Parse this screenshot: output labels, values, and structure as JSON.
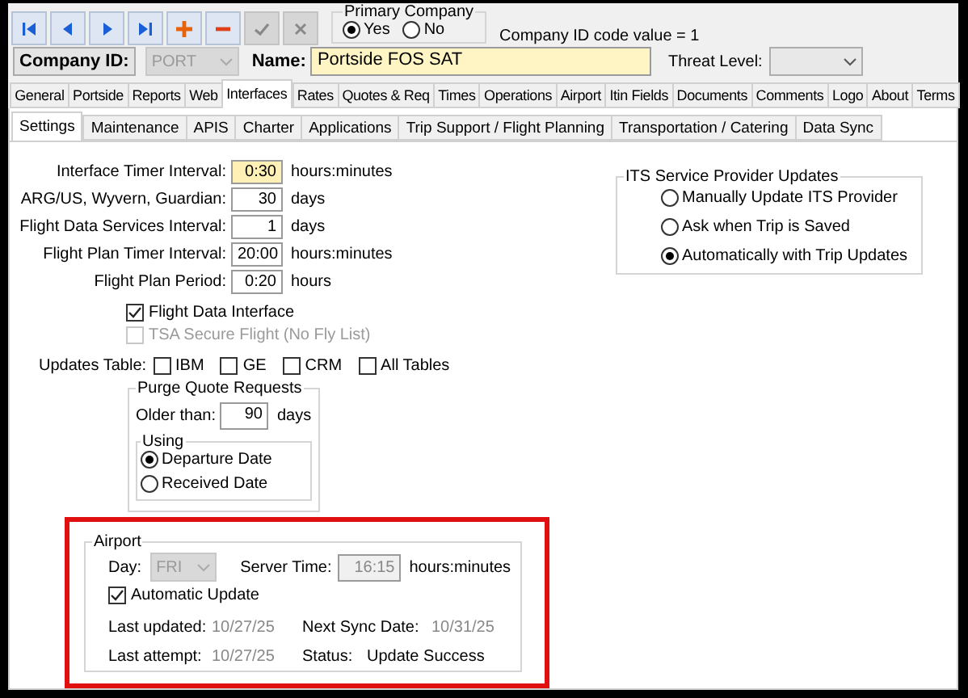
{
  "toolbar": {
    "buttons": [
      {
        "kind": "first",
        "disabled": false
      },
      {
        "kind": "prev",
        "disabled": false
      },
      {
        "kind": "next",
        "disabled": false
      },
      {
        "kind": "last",
        "disabled": false
      },
      {
        "kind": "add",
        "disabled": false
      },
      {
        "kind": "remove",
        "disabled": false
      },
      {
        "kind": "save",
        "disabled": true
      },
      {
        "kind": "cancel",
        "disabled": true
      }
    ]
  },
  "primary_company": {
    "title": "Primary Company",
    "options": [
      {
        "label": "Yes",
        "selected": true
      },
      {
        "label": "No",
        "selected": false
      }
    ]
  },
  "company_id_note": "Company ID code value = 1",
  "company_id": {
    "label": "Company ID:",
    "value": "PORT",
    "disabled": true
  },
  "name": {
    "label": "Name:",
    "value": "Portside FOS SAT"
  },
  "threat_level": {
    "label": "Threat Level:"
  },
  "tabs": [
    {
      "label": "General",
      "selected": false
    },
    {
      "label": "Portside",
      "selected": false
    },
    {
      "label": "Reports",
      "selected": false
    },
    {
      "label": "Web",
      "selected": false
    },
    {
      "label": "Interfaces",
      "selected": true
    },
    {
      "label": "Rates",
      "selected": false
    },
    {
      "label": "Quotes & Req",
      "selected": false
    },
    {
      "label": "Times",
      "selected": false
    },
    {
      "label": "Operations",
      "selected": false
    },
    {
      "label": "Airport",
      "selected": false
    },
    {
      "label": "Itin Fields",
      "selected": false
    },
    {
      "label": "Documents",
      "selected": false
    },
    {
      "label": "Comments",
      "selected": false
    },
    {
      "label": "Logo",
      "selected": false
    },
    {
      "label": "About",
      "selected": false
    },
    {
      "label": "Terms",
      "selected": false
    }
  ],
  "subtabs": [
    {
      "label": "Settings",
      "selected": true
    },
    {
      "label": "Maintenance",
      "selected": false
    },
    {
      "label": "APIS",
      "selected": false
    },
    {
      "label": "Charter",
      "selected": false
    },
    {
      "label": "Applications",
      "selected": false
    },
    {
      "label": "Trip Support / Flight Planning",
      "selected": false
    },
    {
      "label": "Transportation / Catering",
      "selected": false
    },
    {
      "label": "Data Sync",
      "selected": false
    }
  ],
  "intervals": [
    {
      "label": "Interface Timer Interval:",
      "value": "0:30",
      "unit": "hours:minutes",
      "focused": true
    },
    {
      "label": "ARG/US, Wyvern, Guardian:",
      "value": "30",
      "unit": "days",
      "focused": false
    },
    {
      "label": "Flight Data Services Interval:",
      "value": "1",
      "unit": "days",
      "focused": false
    },
    {
      "label": "Flight Plan Timer Interval:",
      "value": "20:00",
      "unit": "hours:minutes",
      "focused": false
    },
    {
      "label": "Flight Plan Period:",
      "value": "0:20",
      "unit": "hours",
      "focused": false
    }
  ],
  "options": [
    {
      "label": "Flight Data Interface",
      "checked": true,
      "disabled": false
    },
    {
      "label": "TSA Secure Flight (No Fly List)",
      "checked": false,
      "disabled": true
    }
  ],
  "updates_table": {
    "label": "Updates Table:",
    "options": [
      {
        "label": "IBM",
        "checked": false
      },
      {
        "label": "GE",
        "checked": false
      },
      {
        "label": "CRM",
        "checked": false
      },
      {
        "label": "All Tables",
        "checked": false
      }
    ]
  },
  "purge": {
    "title": "Purge Quote Requests",
    "older_than_label": "Older than:",
    "older_than_value": "90",
    "unit": "days",
    "using": {
      "title": "Using",
      "options": [
        {
          "label": "Departure Date",
          "selected": true
        },
        {
          "label": "Received Date",
          "selected": false
        }
      ]
    }
  },
  "its_updates": {
    "title": "ITS Service Provider Updates",
    "options": [
      {
        "label": "Manually Update ITS Provider",
        "selected": false
      },
      {
        "label": "Ask when Trip is Saved",
        "selected": false
      },
      {
        "label": "Automatically with Trip Updates",
        "selected": true
      }
    ]
  },
  "airport": {
    "highlighted": true,
    "title": "Airport",
    "day_label": "Day:",
    "day_value": "FRI",
    "server_time_label": "Server Time:",
    "server_time_value": "16:15",
    "server_time_unit": "hours:minutes",
    "automatic_update": {
      "label": "Automatic Update",
      "checked": true
    },
    "last_updated_label": "Last updated:",
    "last_updated_value": "10/27/25",
    "next_sync_label": "Next Sync Date:",
    "next_sync_value": "10/31/25",
    "last_attempt_label": "Last attempt:",
    "last_attempt_value": "10/27/25",
    "status_label": "Status:",
    "status_value": "Update Success"
  }
}
